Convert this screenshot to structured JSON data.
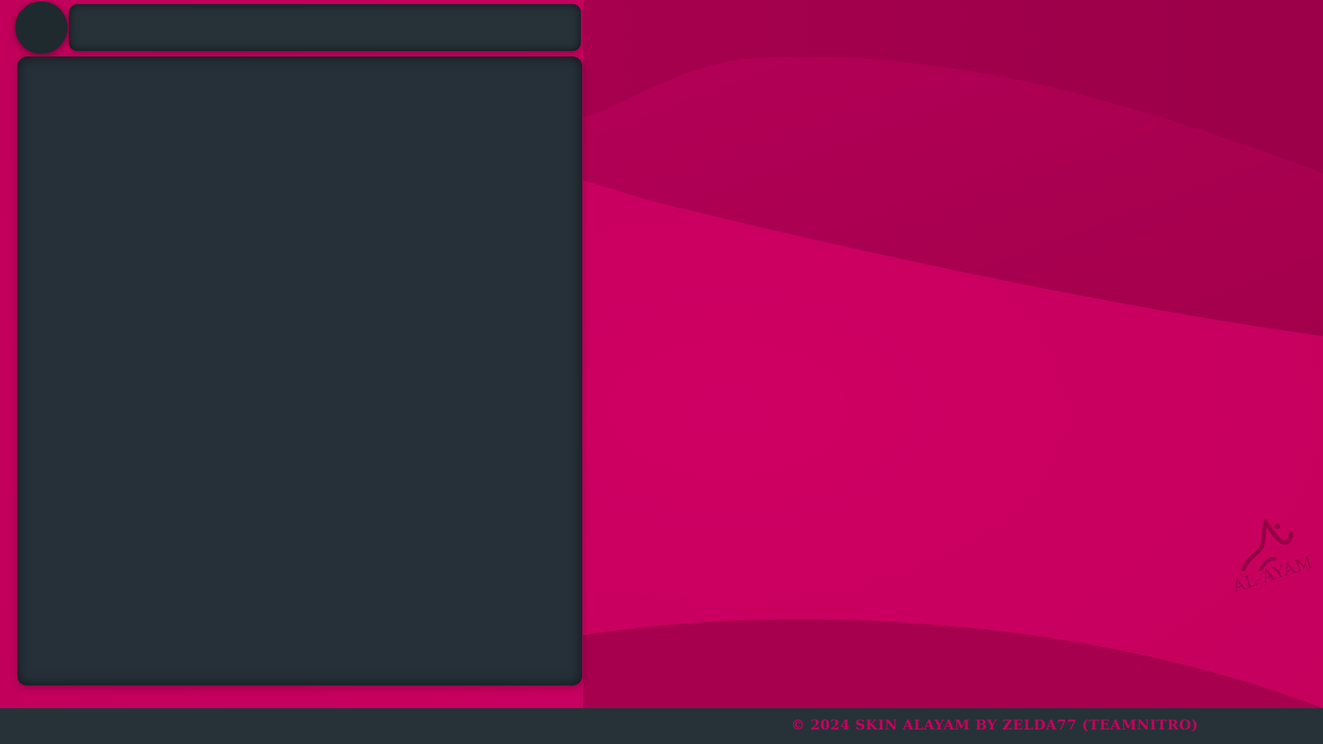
{
  "colors": {
    "background": "#c7005f",
    "panel": "#263038",
    "panel_dark": "#1f2a2f",
    "bottom_bar": "#263238",
    "accent_text": "#c7005f"
  },
  "footer": {
    "copyright": "©  2024 SKIN ALAYAM BY ZELDA77 (TEAMNITRO)"
  },
  "logo": {
    "text": "AL-AYAM",
    "icon_name": "calligraphy-logo-icon"
  }
}
